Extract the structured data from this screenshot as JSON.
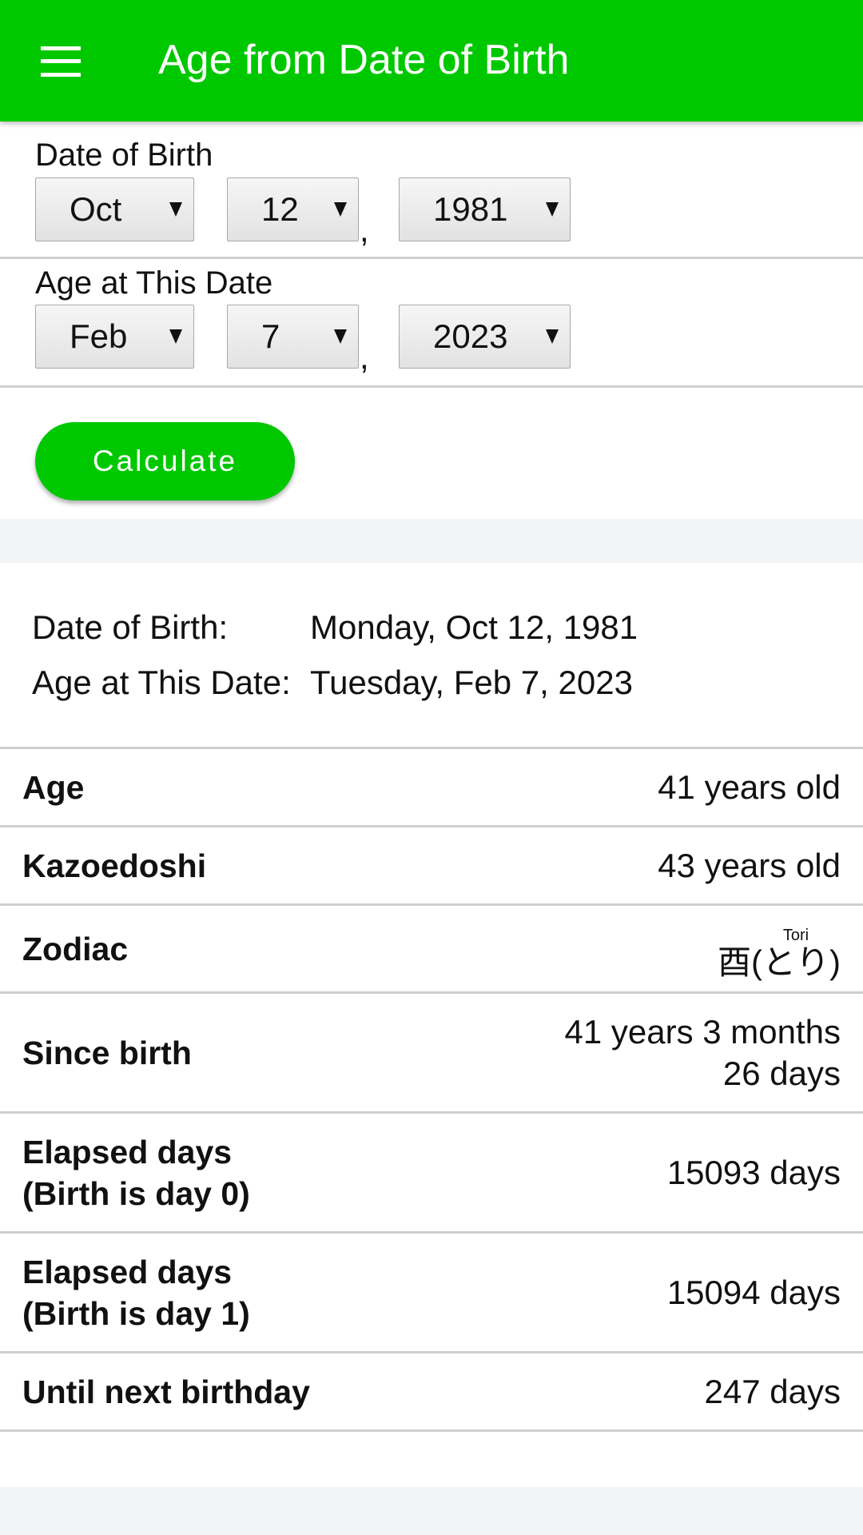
{
  "appbar": {
    "menu_icon": "hamburger-menu-icon",
    "title": "Age from Date of Birth"
  },
  "colors": {
    "accent": "#00c800",
    "divider": "#cfcfcf",
    "background": "#f3f4f6"
  },
  "form": {
    "birth": {
      "label": "Date of Birth",
      "month": "Oct",
      "day": "12",
      "year": "1981"
    },
    "target": {
      "label": "Age at This Date",
      "month": "Feb",
      "day": "7",
      "year": "2023"
    },
    "separator": ",",
    "calculate_label": "Calculate"
  },
  "summary": {
    "birth_label": "Date of Birth:",
    "birth_value": "Monday, Oct 12, 1981",
    "target_label": "Age at This Date:",
    "target_value": "Tuesday, Feb 7, 2023"
  },
  "results": {
    "age": {
      "label": "Age",
      "value": "41 years old"
    },
    "kazoedoshi": {
      "label": "Kazoedoshi",
      "value": "43 years old"
    },
    "zodiac": {
      "label": "Zodiac",
      "kanji": "酉",
      "open": "(",
      "kana": "とり",
      "close": ")",
      "reading": "Tori"
    },
    "since_birth": {
      "label": "Since birth",
      "line1": "41 years 3 months",
      "line2": "26 days"
    },
    "elapsed0": {
      "label_line1": "Elapsed days",
      "label_line2": "(Birth is day 0)",
      "value": "15093 days"
    },
    "elapsed1": {
      "label_line1": "Elapsed days",
      "label_line2": "(Birth is day 1)",
      "value": "15094 days"
    },
    "next_birthday": {
      "label": "Until next birthday",
      "value": "247 days"
    }
  }
}
